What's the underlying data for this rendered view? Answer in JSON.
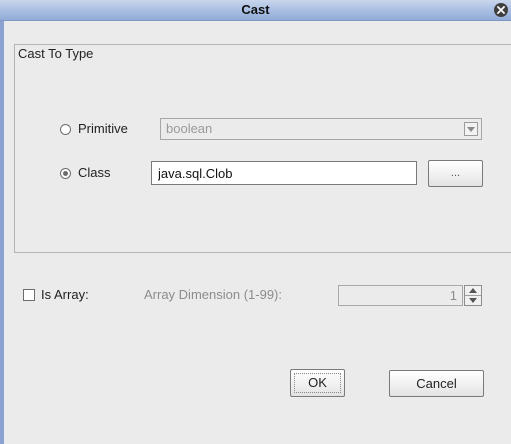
{
  "dialog": {
    "title": "Cast"
  },
  "cast_to_type": {
    "legend": "Cast To Type",
    "primitive": {
      "label": "Primitive",
      "selected": false,
      "combo_value": "boolean",
      "enabled": false
    },
    "class": {
      "label": "Class",
      "selected": true,
      "value": "java.sql.Clob",
      "browse_label": "..."
    }
  },
  "array": {
    "checkbox_label": "Is Array:",
    "checked": false,
    "dimension_label": "Array Dimension (1-99):",
    "dimension_value": "1"
  },
  "buttons": {
    "ok_label": "OK",
    "cancel_label": "Cancel"
  },
  "icons": {
    "close": "close-icon",
    "combo_arrow": "chevron-down-icon",
    "spin_up": "spin-up-icon",
    "spin_down": "spin-down-icon"
  },
  "colors": {
    "titlebar": "#a7bde2",
    "dialog_bg": "#ebebeb"
  }
}
